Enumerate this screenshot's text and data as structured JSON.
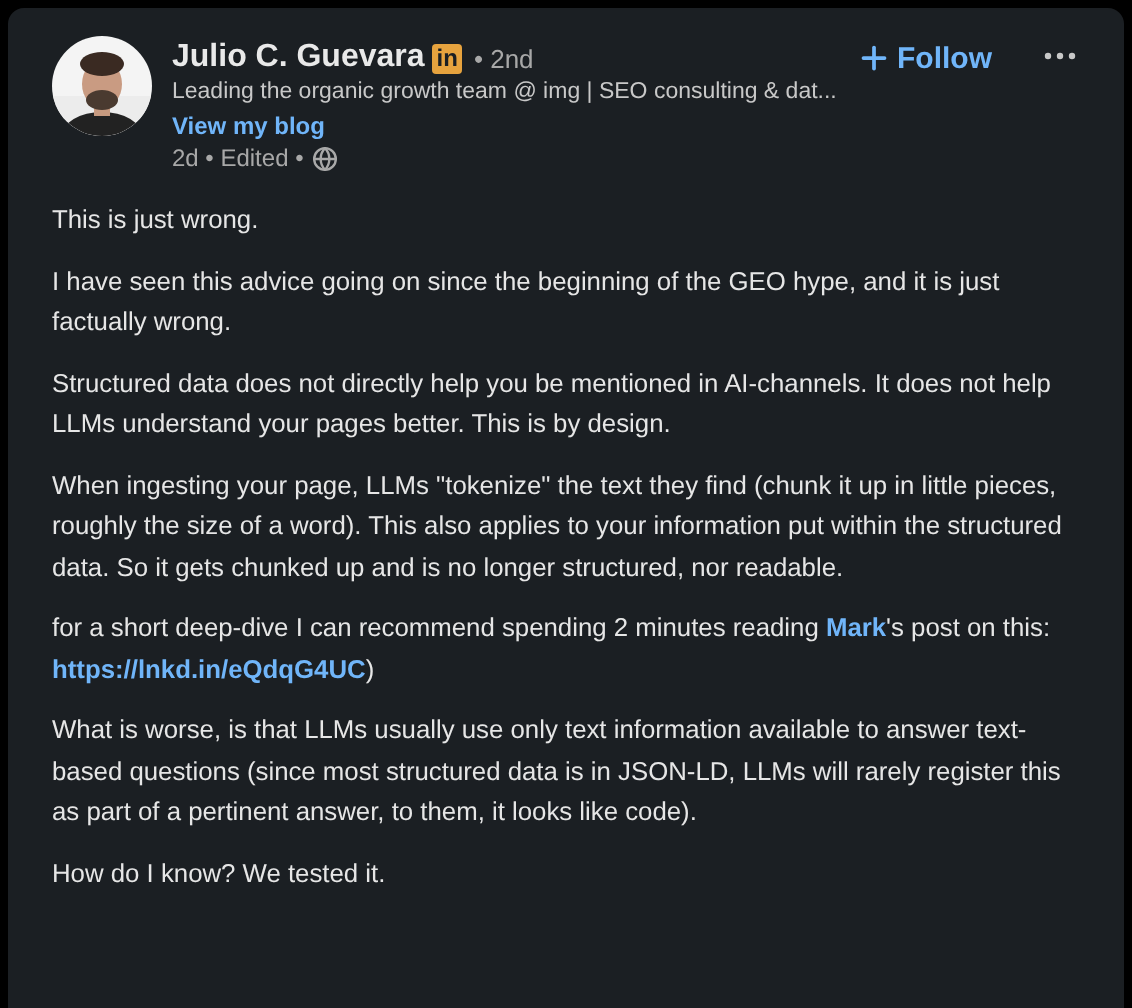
{
  "author": {
    "name": "Julio C. Guevara",
    "badge": "in",
    "degree": "• 2nd",
    "headline": "Leading the organic growth team @ img | SEO consulting & dat...",
    "link": "View my blog",
    "meta": "2d • Edited •"
  },
  "follow": {
    "label": "Follow"
  },
  "paragraphs": [
    [
      {
        "kind": "text",
        "text": "This is just wrong."
      }
    ],
    [
      {
        "kind": "text",
        "text": "I have seen this advice going on since the beginning of the GEO hype, and it is just factually wrong."
      }
    ],
    [
      {
        "kind": "text",
        "text": "Structured data does not directly help you be mentioned in AI-channels. It does not help LLMs understand your pages better. This is by design."
      }
    ],
    [
      {
        "kind": "text",
        "text": "When ingesting your page, LLMs \"tokenize\" the text they find (chunk it up in little pieces, roughly the size of a word). This also applies to your information put within the structured data. So it gets chunked up and is no longer structured, nor readable."
      }
    ],
    [
      {
        "kind": "text",
        "text": "for a short deep-dive I can recommend spending 2 minutes reading "
      },
      {
        "kind": "mention",
        "text": "Mark"
      },
      {
        "kind": "text",
        "text": "'s post on this: "
      },
      {
        "kind": "link",
        "text": "https://lnkd.in/eQdqG4UC"
      },
      {
        "kind": "text",
        "text": ")"
      }
    ],
    [
      {
        "kind": "text",
        "text": "What is worse, is that LLMs usually use only text information available to answer text-based questions (since most structured data is in JSON-LD, LLMs will rarely register this as part of a pertinent answer, to them, it looks like code)."
      }
    ],
    [
      {
        "kind": "text",
        "text": "How do I know? We tested it."
      }
    ]
  ]
}
